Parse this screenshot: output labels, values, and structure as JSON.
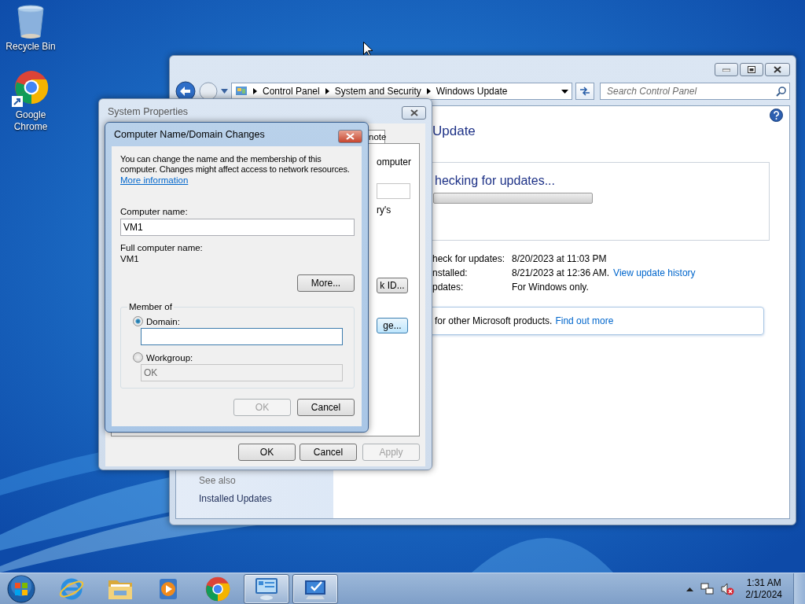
{
  "desktop": {
    "icons": [
      {
        "label": "Recycle Bin",
        "kind": "recycle"
      },
      {
        "label": "Google Chrome",
        "kind": "chrome"
      }
    ]
  },
  "control_panel": {
    "breadcrumb": [
      "Control Panel",
      "System and Security",
      "Windows Update"
    ],
    "search": {
      "placeholder": "Search Control Panel"
    },
    "heading": "Update",
    "status": "hecking for updates...",
    "progress": {
      "level": 0
    },
    "info_rows": [
      {
        "label": "heck for updates:",
        "value": "8/20/2023 at 11:03 PM"
      },
      {
        "label": "nstalled:",
        "value": "8/21/2023 at 12:36 AM.",
        "link": "View update history"
      },
      {
        "label": "pdates:",
        "value": "For Windows only."
      }
    ],
    "notice": {
      "text": "for other Microsoft products.",
      "link": "Find out more"
    },
    "see_also": {
      "title": "See also",
      "items": [
        "Installed Updates"
      ]
    }
  },
  "system_properties": {
    "title": "System Properties",
    "tab": "note",
    "texts": [
      "omputer",
      "ry's"
    ],
    "panel_buttons": [
      {
        "label": "k ID...",
        "focused": false
      },
      {
        "label": "ge...",
        "focused": true
      }
    ],
    "buttons": [
      {
        "label": "OK",
        "disabled": false
      },
      {
        "label": "Cancel",
        "disabled": false
      },
      {
        "label": "Apply",
        "disabled": true
      }
    ]
  },
  "dialog": {
    "title": "Computer Name/Domain Changes",
    "intro": "You can change the name and the membership of this computer. Changes might affect access to network resources.",
    "link": "More information",
    "computer_name": {
      "label": "Computer name:",
      "value": "VM1"
    },
    "full_name": {
      "label": "Full computer name:",
      "value": "VM1"
    },
    "more_button": "More...",
    "member_of": {
      "title": "Member of",
      "options": [
        {
          "label": "Domain:",
          "selected": true
        },
        {
          "label": "Workgroup:",
          "selected": false,
          "value": "OK"
        }
      ]
    },
    "buttons": [
      {
        "label": "OK",
        "disabled": true
      },
      {
        "label": "Cancel",
        "disabled": false
      }
    ]
  },
  "taskbar": {
    "apps": [
      {
        "kind": "ie",
        "active": false
      },
      {
        "kind": "explorer",
        "active": false
      },
      {
        "kind": "media",
        "active": false
      },
      {
        "kind": "chrome",
        "active": false
      },
      {
        "kind": "control-panel",
        "active": true
      },
      {
        "kind": "system",
        "active": true
      }
    ],
    "clock": {
      "time": "1:31 AM",
      "date": "2/1/2024"
    }
  }
}
